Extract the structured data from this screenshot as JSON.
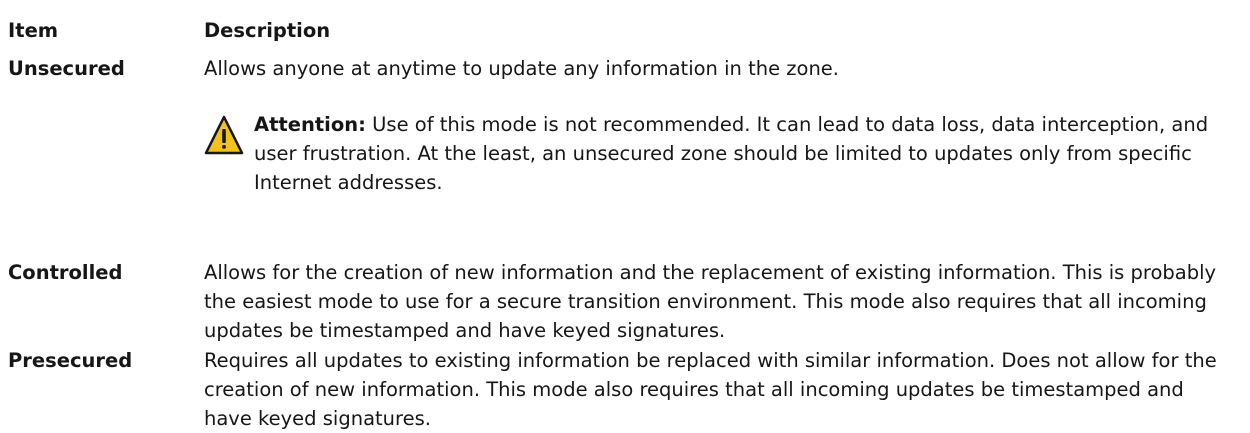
{
  "header": {
    "item_label": "Item",
    "description_label": "Description"
  },
  "rows": [
    {
      "term": "Unsecured",
      "description": "Allows anyone at anytime to update any information in the zone.",
      "attention": {
        "label": "Attention:",
        "text": "Use of this mode is not recommended. It can lead to data loss, data interception, and user frustration. At the least, an unsecured zone should be limited to updates only from specific Internet addresses.",
        "icon": "warning-triangle-icon"
      }
    },
    {
      "term": "Controlled",
      "description": "Allows for the creation of new information and the replacement of existing information. This is probably the easiest mode to use for a secure transition environment. This mode also requires that all incoming updates be timestamped and have keyed signatures."
    },
    {
      "term": "Presecured",
      "description": "Requires all updates to existing information be replaced with similar information. Does not allow for the creation of new information. This mode also requires that all incoming updates be timestamped and have keyed signatures."
    }
  ],
  "colors": {
    "text": "#161616",
    "warning_fill": "#f1c21b",
    "warning_stroke": "#161616"
  }
}
